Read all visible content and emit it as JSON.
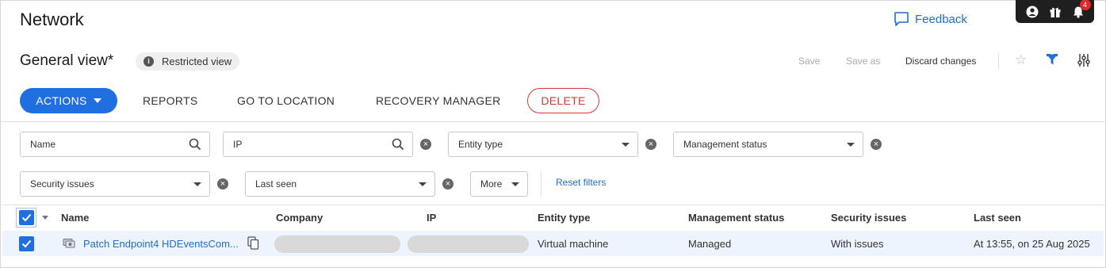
{
  "header": {
    "title": "Network",
    "feedback_label": "Feedback",
    "notification_count": "4",
    "view_name": "General view*",
    "restricted_label": "Restricted view",
    "save_label": "Save",
    "save_as_label": "Save as",
    "discard_label": "Discard changes"
  },
  "toolbar": {
    "actions_label": "ACTIONS",
    "reports_label": "REPORTS",
    "goto_label": "GO TO LOCATION",
    "recovery_label": "RECOVERY MANAGER",
    "delete_label": "DELETE"
  },
  "filters": {
    "name": "Name",
    "ip": "IP",
    "entity_type": "Entity type",
    "management_status": "Management status",
    "security_issues": "Security issues",
    "last_seen": "Last seen",
    "more": "More",
    "reset": "Reset filters"
  },
  "table": {
    "columns": [
      "Name",
      "Company",
      "IP",
      "Entity type",
      "Management status",
      "Security issues",
      "Last seen"
    ],
    "rows": [
      {
        "name": "Patch Endpoint4 HDEventsCom...",
        "entity_type": "Virtual machine",
        "management_status": "Managed",
        "security_issues": "With issues",
        "last_seen": "At 13:55, on 25 Aug 2025"
      }
    ]
  },
  "colors": {
    "accent": "#1f6fe0",
    "link": "#1f6fcf",
    "danger": "#d83a3a",
    "row_selected": "#eef4fd"
  }
}
